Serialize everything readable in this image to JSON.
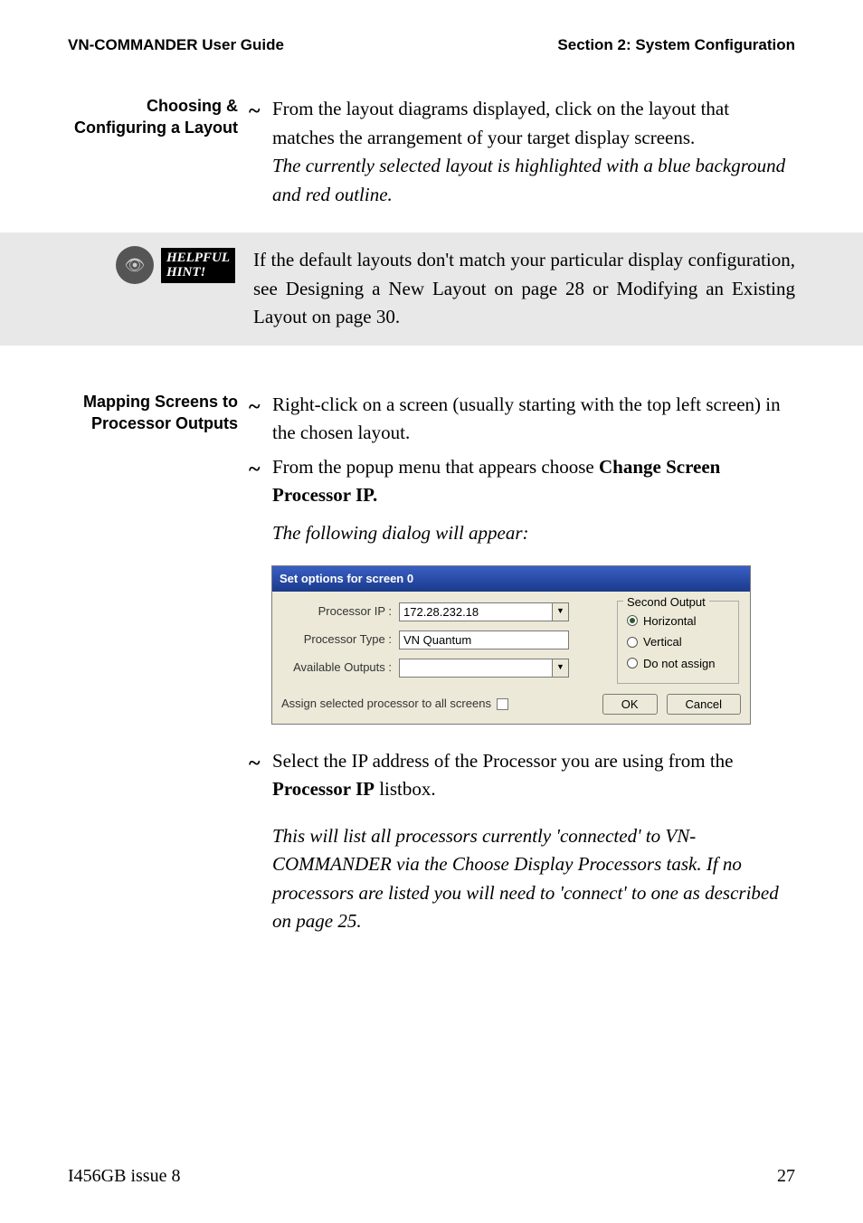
{
  "header": {
    "left": "VN-COMMANDER User Guide",
    "right": "Section 2: System Configuration"
  },
  "section1": {
    "heading": "Choosing & Configuring a Layout",
    "bullet1": "From the layout diagrams displayed, click on the layout that matches the arrangement of your target display screens.",
    "italic1": "The currently selected layout is highlighted with a blue background and red outline."
  },
  "hint": {
    "label_line1": "HELPFUL",
    "label_line2": "HINT!",
    "text": "If the default layouts don't match your particular display configuration, see Designing a New Layout on page 28 or Modifying an Existing Layout on page 30."
  },
  "section2": {
    "heading": "Mapping Screens to Processor Outputs",
    "bullet1": "Right-click on a screen (usually starting with the top left screen) in the chosen layout.",
    "bullet2_pre": "From the popup menu that appears choose ",
    "bullet2_bold": "Change Screen Processor IP.",
    "italic1": "The following dialog will appear:",
    "bullet3_pre": "Select the IP address of the Processor you are using from the ",
    "bullet3_bold": "Processor IP",
    "bullet3_post": " listbox.",
    "italic2": "This will list all processors currently 'connected' to VN-COMMANDER via the Choose Display Processors task. If no processors are listed you will need to 'connect' to one as described on page 25."
  },
  "dialog": {
    "title": "Set options for screen 0",
    "labels": {
      "processor_ip": "Processor IP :",
      "processor_type": "Processor Type :",
      "available_outputs": "Available Outputs :"
    },
    "values": {
      "processor_ip": "172.28.232.18",
      "processor_type": "VN Quantum",
      "available_outputs": ""
    },
    "groupbox": {
      "title": "Second Output",
      "options": {
        "horizontal": "Horizontal",
        "vertical": "Vertical",
        "do_not_assign": "Do not assign"
      },
      "selected": "horizontal"
    },
    "checkbox_label": "Assign selected processor to all screens",
    "buttons": {
      "ok": "OK",
      "cancel": "Cancel"
    }
  },
  "footer": {
    "left": "I456GB issue 8",
    "right": "27"
  }
}
